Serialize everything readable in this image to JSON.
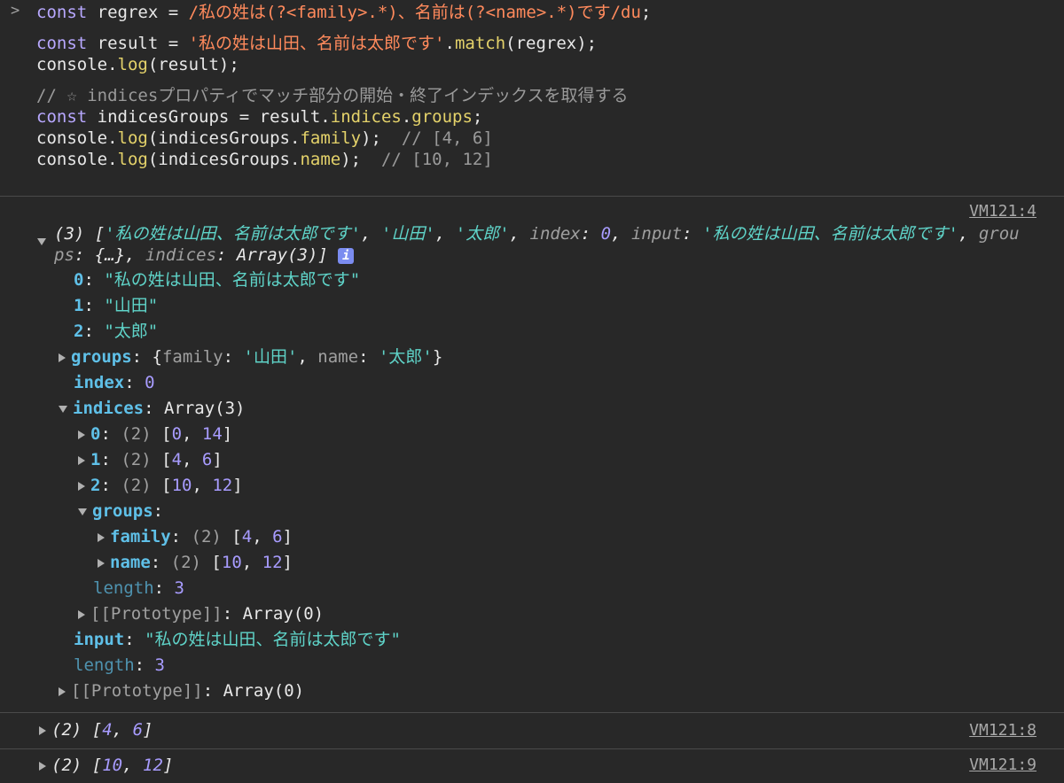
{
  "input": {
    "prompt": ">",
    "line1": {
      "kw": "const",
      "name": " regrex = ",
      "regex": "/私の姓は(?<family>.*)、名前は(?<name>.*)です/du",
      "end": ";"
    },
    "line2": {
      "kw": "const",
      "name": " result = ",
      "str": "'私の姓は山田、名前は太郎です'",
      "dot": ".",
      "method": "match",
      "args": "(regrex);"
    },
    "line3": {
      "pre": "console.",
      "method": "log",
      "args": "(result);"
    },
    "line4": {
      "comment": "// ☆ indicesプロパティでマッチ部分の開始・終了インデックスを取得する"
    },
    "line5": {
      "kw": "const",
      "name": " indicesGroups = result.",
      "m1": "indices",
      "dot": ".",
      "m2": "groups",
      "end": ";"
    },
    "line6": {
      "pre": "console.",
      "method": "log",
      "a1": "(indicesGroups.",
      "prop": "family",
      "a2": ");  ",
      "comment": "// [4, 6]"
    },
    "line7": {
      "pre": "console.",
      "method": "log",
      "a1": "(indicesGroups.",
      "prop": "name",
      "a2": ");  ",
      "comment": "// [10, 12]"
    }
  },
  "log1": {
    "link": "VM121:4",
    "summary_a": "(3) [",
    "s1": "'私の姓は山田、名前は太郎です'",
    "c1": ", ",
    "s2": "'山田'",
    "c2": ", ",
    "s3": "'太郎'",
    "c3": ", ",
    "k_index": "index",
    "colon": ": ",
    "v_index": "0",
    "c4": ", ",
    "k_input": "input",
    "s4": "'私の姓は山田、名前は太郎です'",
    "c5": ", ",
    "k_grou": "grou",
    "k_ps": "ps",
    "ps_val": ": {…}, ",
    "k_indices": "indices",
    "ind_val": ": Array(3)] ",
    "info": "i",
    "items": {
      "k0": "0",
      "v0": "\"私の姓は山田、名前は太郎です\"",
      "k1": "1",
      "v1": "\"山田\"",
      "k2": "2",
      "v2": "\"太郎\"",
      "groups_key": "groups",
      "groups_open": "{",
      "groups_family_k": "family",
      "groups_family_v": "'山田'",
      "groups_sep": ", ",
      "groups_name_k": "name",
      "groups_name_v": "'太郎'",
      "groups_close": "}",
      "index_key": "index",
      "index_val": "0",
      "indices_key": "indices",
      "indices_val": "Array(3)",
      "ind0_k": "0",
      "ind0_len": "(2) ",
      "ind0_a": "0",
      "ind0_b": "14",
      "ind1_k": "1",
      "ind1_len": "(2) ",
      "ind1_a": "4",
      "ind1_b": "6",
      "ind2_k": "2",
      "ind2_len": "(2) ",
      "ind2_a": "10",
      "ind2_b": "12",
      "ig_key": "groups",
      "ig_family_k": "family",
      "ig_family_len": "(2) ",
      "ig_family_a": "4",
      "ig_family_b": "6",
      "ig_name_k": "name",
      "ig_name_len": "(2) ",
      "ig_name_a": "10",
      "ig_name_b": "12",
      "ig_length_k": "length",
      "ig_length_v": "3",
      "ind_proto": "[[Prototype]]",
      "ind_proto_v": "Array(0)",
      "input_key": "input",
      "input_val": "\"私の姓は山田、名前は太郎です\"",
      "length_key": "length",
      "length_val": "3",
      "proto": "[[Prototype]]",
      "proto_v": "Array(0)"
    }
  },
  "log2": {
    "link": "VM121:8",
    "len": "(2) ",
    "a": "4",
    "b": "6"
  },
  "log3": {
    "link": "VM121:9",
    "len": "(2) ",
    "a": "10",
    "b": "12"
  }
}
